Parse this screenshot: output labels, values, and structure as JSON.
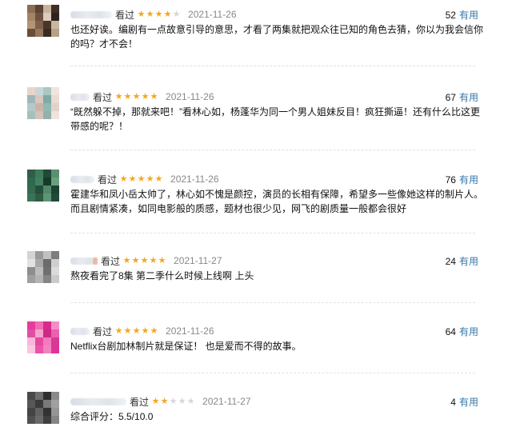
{
  "reviews": [
    {
      "label": "看过",
      "stars": 4,
      "date": "2021-11-26",
      "votes": "52",
      "useful_label": "有用",
      "content": "也还好诶。编剧有一点故意引导的意思，才看了两集就把观众往已知的角色去猜，你以为我会信你的吗？才不会！"
    },
    {
      "label": "看过",
      "stars": 5,
      "date": "2021-11-26",
      "votes": "67",
      "useful_label": "有用",
      "content": "“既然躲不掉，那就来吧！”看林心如，杨蓬华为同一个男人姐妹反目！疯狂撕逼！还有什么比这更带感的呢？！"
    },
    {
      "label": "看过",
      "stars": 5,
      "date": "2021-11-26",
      "votes": "76",
      "useful_label": "有用",
      "content": "霍建华和凤小岳太帅了，林心如不愧是颜控，演员的长相有保障，希望多一些像她这样的制片人。而且剧情紧凑，如同电影般的质感，题材也很少见，网飞的剧质量一般都会很好"
    },
    {
      "label": "看过",
      "stars": 5,
      "date": "2021-11-27",
      "votes": "24",
      "useful_label": "有用",
      "content": "熬夜看完了8集 第二季什么时候上线啊 上头"
    },
    {
      "label": "看过",
      "stars": 5,
      "date": "2021-11-26",
      "votes": "64",
      "useful_label": "有用",
      "content": "Netflix台剧加林制片就是保证！ 也是爱而不得的故事。"
    },
    {
      "label": "看过",
      "stars": 2,
      "date": "2021-11-27",
      "votes": "4",
      "useful_label": "有用",
      "content": "综合评分：5.5/10.0"
    }
  ],
  "colors": {
    "star_on": "#f5a623",
    "star_off": "#d6d6d6",
    "link": "#3377aa",
    "date": "#888888"
  }
}
